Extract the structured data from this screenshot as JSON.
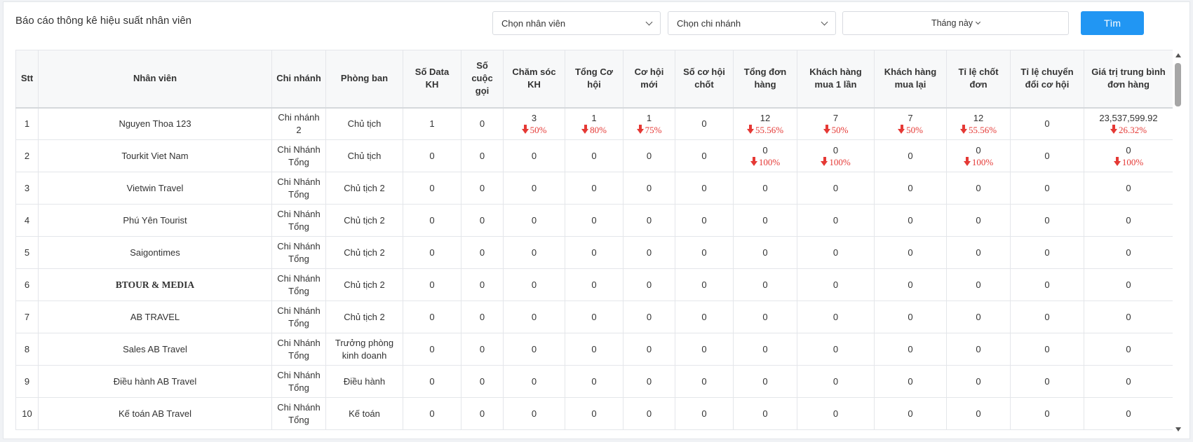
{
  "page": {
    "title": "Báo cáo thông kê hiệu suất nhân viên"
  },
  "filters": {
    "employee": "Chọn nhân viên",
    "branch": "Chọn chi nhánh",
    "month": "Tháng này",
    "search_label": "Tìm"
  },
  "colors": {
    "accent": "#2196f3",
    "decrease": "#e53935"
  },
  "table": {
    "headers": [
      "Stt",
      "Nhân viên",
      "Chi nhánh",
      "Phòng ban",
      "Số Data KH",
      "Số cuộc gọi",
      "Chăm sóc KH",
      "Tổng Cơ hội",
      "Cơ hội mới",
      "Số cơ hội chốt",
      "Tổng đơn hàng",
      "Khách hàng mua 1 lần",
      "Khách hàng mua lại",
      "Tỉ lệ chốt đơn",
      "Tỉ lệ chuyển đổi cơ hội",
      "Giá trị trung bình đơn hàng"
    ],
    "rows": [
      [
        "1",
        "Nguyen Thoa 123",
        "Chi nhánh 2",
        "Chủ tịch",
        "1",
        "0",
        {
          "v": "3",
          "d": "50%"
        },
        {
          "v": "1",
          "d": "80%"
        },
        {
          "v": "1",
          "d": "75%"
        },
        "0",
        {
          "v": "12",
          "d": "55.56%"
        },
        {
          "v": "7",
          "d": "50%"
        },
        {
          "v": "7",
          "d": "50%"
        },
        {
          "v": "12",
          "d": "55.56%"
        },
        "0",
        {
          "v": "23,537,599.92",
          "d": "26.32%"
        }
      ],
      [
        "2",
        "Tourkit Viet Nam",
        "Chi Nhánh Tổng",
        "Chủ tịch",
        "0",
        "0",
        "0",
        "0",
        "0",
        "0",
        {
          "v": "0",
          "d": "100%"
        },
        {
          "v": "0",
          "d": "100%"
        },
        "0",
        {
          "v": "0",
          "d": "100%"
        },
        "0",
        {
          "v": "0",
          "d": "100%"
        }
      ],
      [
        "3",
        "Vietwin Travel",
        "Chi Nhánh Tổng",
        "Chủ tịch 2",
        "0",
        "0",
        "0",
        "0",
        "0",
        "0",
        "0",
        "0",
        "0",
        "0",
        "0",
        "0"
      ],
      [
        "4",
        "Phú Yên Tourist",
        "Chi Nhánh Tổng",
        "Chủ tịch 2",
        "0",
        "0",
        "0",
        "0",
        "0",
        "0",
        "0",
        "0",
        "0",
        "0",
        "0",
        "0"
      ],
      [
        "5",
        "Saigontimes",
        "Chi Nhánh Tổng",
        "Chủ tịch 2",
        "0",
        "0",
        "0",
        "0",
        "0",
        "0",
        "0",
        "0",
        "0",
        "0",
        "0",
        "0"
      ],
      [
        "6",
        "BTOUR & MEDIA",
        "Chi Nhánh Tổng",
        "Chủ tịch 2",
        "0",
        "0",
        "0",
        "0",
        "0",
        "0",
        "0",
        "0",
        "0",
        "0",
        "0",
        "0"
      ],
      [
        "7",
        "AB TRAVEL",
        "Chi Nhánh Tổng",
        "Chủ tịch 2",
        "0",
        "0",
        "0",
        "0",
        "0",
        "0",
        "0",
        "0",
        "0",
        "0",
        "0",
        "0"
      ],
      [
        "8",
        "Sales AB Travel",
        "Chi Nhánh Tổng",
        "Trưởng phòng kinh doanh",
        "0",
        "0",
        "0",
        "0",
        "0",
        "0",
        "0",
        "0",
        "0",
        "0",
        "0",
        "0"
      ],
      [
        "9",
        "Điều hành AB Travel",
        "Chi Nhánh Tổng",
        "Điều hành",
        "0",
        "0",
        "0",
        "0",
        "0",
        "0",
        "0",
        "0",
        "0",
        "0",
        "0",
        "0"
      ],
      [
        "10",
        "Kế toán AB Travel",
        "Chi Nhánh Tổng",
        "Kế toán",
        "0",
        "0",
        "0",
        "0",
        "0",
        "0",
        "0",
        "0",
        "0",
        "0",
        "0",
        "0"
      ]
    ]
  }
}
